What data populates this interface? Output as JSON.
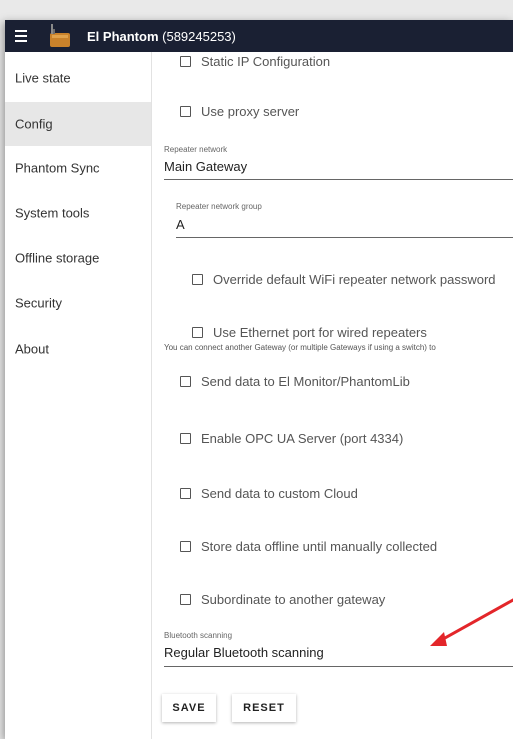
{
  "app": {
    "name": "El Phantom",
    "id": "(589245253)",
    "bar_color": "#1a2033",
    "accent_arrow_color": "#e3262a"
  },
  "sidebar": {
    "items": [
      {
        "label": "Live state",
        "active": false
      },
      {
        "label": "Config",
        "active": true
      },
      {
        "label": "Phantom Sync",
        "active": false
      },
      {
        "label": "System tools",
        "active": false
      },
      {
        "label": "Offline storage",
        "active": false
      },
      {
        "label": "Security",
        "active": false
      },
      {
        "label": "About",
        "active": false
      }
    ]
  },
  "config": {
    "static_ip": {
      "label": "Static IP Configuration",
      "checked": false
    },
    "proxy": {
      "label": "Use proxy server",
      "checked": false
    },
    "repeater_network": {
      "label": "Repeater network",
      "value": "Main Gateway"
    },
    "repeater_group": {
      "label": "Repeater network group",
      "value": "A"
    },
    "override_wifi": {
      "label": "Override default WiFi repeater network password",
      "checked": false
    },
    "ethernet": {
      "label": "Use Ethernet port for wired repeaters",
      "checked": false
    },
    "ethernet_hint": "You can connect another Gateway (or multiple Gateways if using a switch) to",
    "el_monitor": {
      "label": "Send data to El Monitor/PhantomLib",
      "checked": false
    },
    "opc_ua": {
      "label": "Enable OPC UA Server (port 4334)",
      "checked": false
    },
    "custom_cloud": {
      "label": "Send data to custom Cloud",
      "checked": false
    },
    "offline": {
      "label": "Store data offline until manually collected",
      "checked": false
    },
    "subordinate": {
      "label": "Subordinate to another gateway",
      "checked": false
    },
    "bluetooth": {
      "label": "Bluetooth scanning",
      "value": "Regular Bluetooth scanning"
    }
  },
  "actions": {
    "save": "SAVE",
    "reset": "RESET"
  }
}
